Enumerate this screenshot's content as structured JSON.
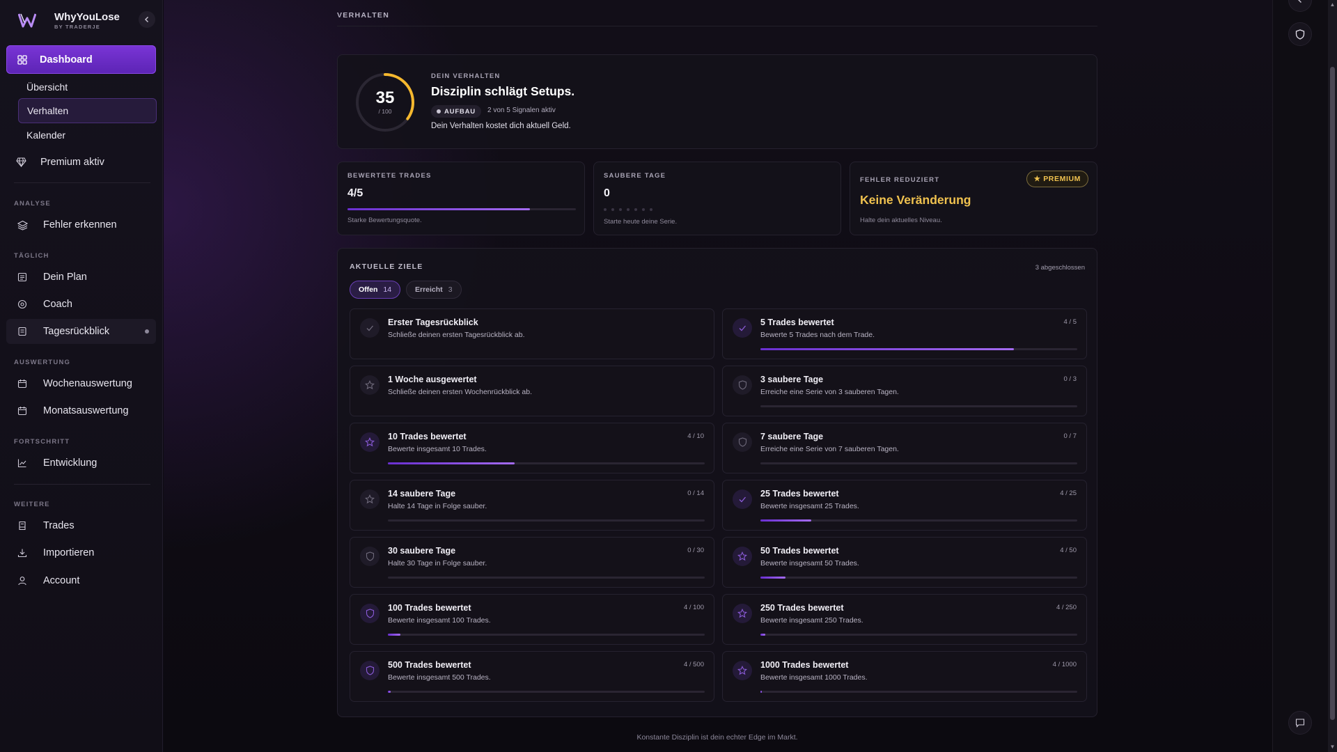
{
  "app": {
    "name": "WhyYouLose",
    "tagline": "BY TRADERJE"
  },
  "sidebar": {
    "main_item": {
      "label": "Dashboard",
      "icon": "grid-icon"
    },
    "sub_items": [
      {
        "label": "Übersicht",
        "active": false
      },
      {
        "label": "Verhalten",
        "active": true
      },
      {
        "label": "Kalender",
        "active": false
      }
    ],
    "premium": {
      "label": "Premium aktiv",
      "icon": "diamond-icon"
    },
    "sections": [
      {
        "title": "ANALYSE",
        "items": [
          {
            "label": "Fehler erkennen",
            "icon": "layers-icon"
          }
        ]
      },
      {
        "title": "TÄGLICH",
        "items": [
          {
            "label": "Dein Plan",
            "icon": "list-icon"
          },
          {
            "label": "Coach",
            "icon": "target-icon"
          },
          {
            "label": "Tagesrückblick",
            "icon": "notebook-icon"
          }
        ]
      },
      {
        "title": "AUSWERTUNG",
        "items": [
          {
            "label": "Wochenauswertung",
            "icon": "calendar-icon"
          },
          {
            "label": "Monatsauswertung",
            "icon": "calendar-icon"
          }
        ]
      },
      {
        "title": "FORTSCHRITT",
        "items": [
          {
            "label": "Entwicklung",
            "icon": "chart-line-icon"
          }
        ]
      },
      {
        "title": "WEITERE",
        "items": [
          {
            "label": "Trades",
            "icon": "receipt-icon"
          },
          {
            "label": "Importieren",
            "icon": "download-icon"
          },
          {
            "label": "Account",
            "icon": "user-icon"
          }
        ]
      }
    ]
  },
  "page": {
    "header": "VERHALTEN",
    "footer": "Konstante Disziplin ist dein echter Edge im Markt."
  },
  "hero": {
    "score": "35",
    "score_max": "/ 100",
    "score_value": 35,
    "eyebrow": "DEIN VERHALTEN",
    "title": "Disziplin schlägt Setups.",
    "badge": "AUFBAU",
    "signals": "2 von 5 Signalen aktiv",
    "description": "Dein Verhalten kostet dich aktuell Geld."
  },
  "stats": {
    "rated": {
      "label": "BEWERTETE TRADES",
      "value": "4/5",
      "progress": 0.8,
      "note": "Starke Bewertungsquote."
    },
    "clean": {
      "label": "SAUBERE TAGE",
      "value": "0",
      "note": "Starte heute deine Serie.",
      "dot_count": 7
    },
    "errors": {
      "label": "FEHLER REDUZIERT",
      "badge": "★ PREMIUM",
      "value": "Keine Veränderung",
      "note": "Halte dein aktuelles Niveau."
    }
  },
  "goals": {
    "title": "AKTUELLE ZIELE",
    "completed": "3 abgeschlossen",
    "tab_open": {
      "label": "Offen",
      "count": "14"
    },
    "tab_done": {
      "label": "Erreicht",
      "count": "3"
    },
    "items": [
      {
        "title": "Erster Tagesrückblick",
        "desc": "Schließe deinen ersten Tagesrückblick ab.",
        "progress_text": "",
        "progress": null,
        "icon": "check-icon"
      },
      {
        "title": "5 Trades bewertet",
        "desc": "Bewerte 5 Trades nach dem Trade.",
        "progress_text": "4 / 5",
        "progress": 0.8,
        "icon": "check-icon"
      },
      {
        "title": "1 Woche ausgewertet",
        "desc": "Schließe deinen ersten Wochenrückblick ab.",
        "progress_text": "",
        "progress": null,
        "icon": "star-icon"
      },
      {
        "title": "3 saubere Tage",
        "desc": "Erreiche eine Serie von 3 sauberen Tagen.",
        "progress_text": "0 / 3",
        "progress": 0,
        "icon": "shield-icon"
      },
      {
        "title": "10 Trades bewertet",
        "desc": "Bewerte insgesamt 10 Trades.",
        "progress_text": "4 / 10",
        "progress": 0.4,
        "icon": "star-icon"
      },
      {
        "title": "7 saubere Tage",
        "desc": "Erreiche eine Serie von 7 sauberen Tagen.",
        "progress_text": "0 / 7",
        "progress": 0,
        "icon": "shield-icon"
      },
      {
        "title": "14 saubere Tage",
        "desc": "Halte 14 Tage in Folge sauber.",
        "progress_text": "0 / 14",
        "progress": 0,
        "icon": "star-icon"
      },
      {
        "title": "25 Trades bewertet",
        "desc": "Bewerte insgesamt 25 Trades.",
        "progress_text": "4 / 25",
        "progress": 0.16,
        "icon": "check-icon"
      },
      {
        "title": "30 saubere Tage",
        "desc": "Halte 30 Tage in Folge sauber.",
        "progress_text": "0 / 30",
        "progress": 0,
        "icon": "shield-icon"
      },
      {
        "title": "50 Trades bewertet",
        "desc": "Bewerte insgesamt 50 Trades.",
        "progress_text": "4 / 50",
        "progress": 0.08,
        "icon": "star-icon"
      },
      {
        "title": "100 Trades bewertet",
        "desc": "Bewerte insgesamt 100 Trades.",
        "progress_text": "4 / 100",
        "progress": 0.04,
        "icon": "shield-icon"
      },
      {
        "title": "250 Trades bewertet",
        "desc": "Bewerte insgesamt 250 Trades.",
        "progress_text": "4 / 250",
        "progress": 0.016,
        "icon": "star-icon"
      },
      {
        "title": "500 Trades bewertet",
        "desc": "Bewerte insgesamt 500 Trades.",
        "progress_text": "4 / 500",
        "progress": 0.008,
        "icon": "shield-icon"
      },
      {
        "title": "1000 Trades bewertet",
        "desc": "Bewerte insgesamt 1000 Trades.",
        "progress_text": "4 / 1000",
        "progress": 0.004,
        "icon": "star-icon"
      }
    ]
  },
  "colors": {
    "accent": "#7a35d6",
    "gold": "#f0c24f",
    "gauge": "#f5b82e"
  }
}
